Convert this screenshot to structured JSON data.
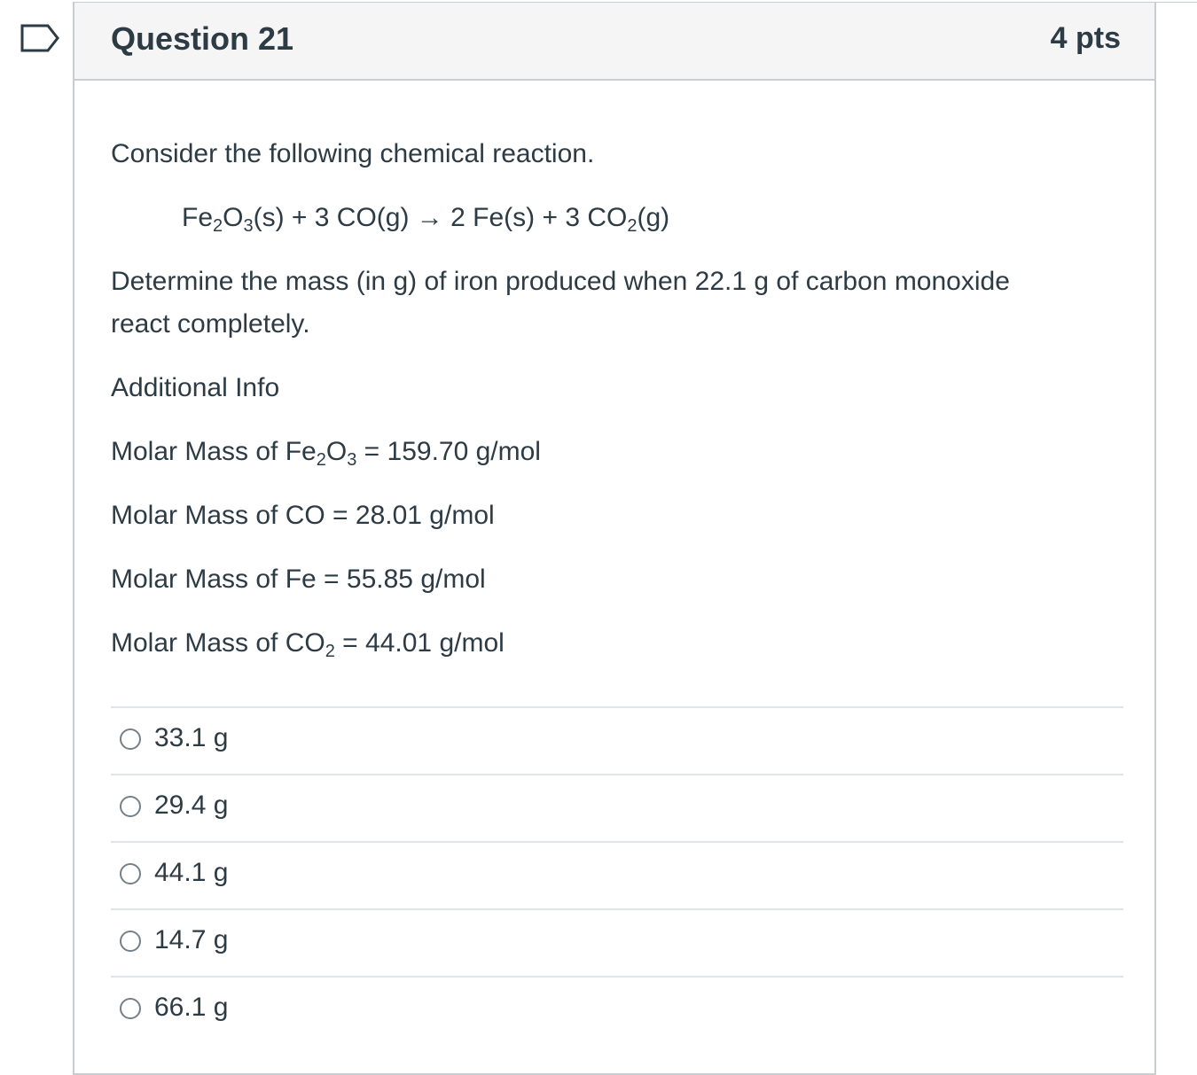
{
  "question": {
    "title": "Question 21",
    "points": "4 pts"
  },
  "body": {
    "intro": "Consider the following chemical reaction.",
    "reaction": {
      "fe2o3_a": "Fe",
      "fe2o3_sub1": "2",
      "fe2o3_b": "O",
      "fe2o3_sub2": "3",
      "middle": "(s) + 3 CO(g) → 2 Fe(s) + 3 CO",
      "co2_sub": "2",
      "end": "(g)"
    },
    "prompt_line1": "Determine the mass (in g) of iron produced when 22.1 g of carbon monoxide",
    "prompt_line2": "react completely.",
    "additional_info": "Additional Info",
    "molar_mass_fe2o3": {
      "prefix": "Molar Mass of Fe",
      "sub1": "2",
      "mid": "O",
      "sub2": "3",
      "suffix": " = 159.70 g/mol"
    },
    "molar_mass_co": "Molar Mass of CO = 28.01 g/mol",
    "molar_mass_fe": "Molar Mass of Fe = 55.85 g/mol",
    "molar_mass_co2": {
      "prefix": "Molar Mass of CO",
      "sub": "2",
      "suffix": " = 44.01 g/mol"
    }
  },
  "answers": [
    {
      "label": "33.1 g"
    },
    {
      "label": "29.4 g"
    },
    {
      "label": "44.1 g"
    },
    {
      "label": "14.7 g"
    },
    {
      "label": "66.1 g"
    }
  ],
  "colors": {
    "text": "#2d3b45",
    "header_bg": "#f5f5f5",
    "border": "#c7cdd1",
    "flag": "#2d3b45"
  }
}
